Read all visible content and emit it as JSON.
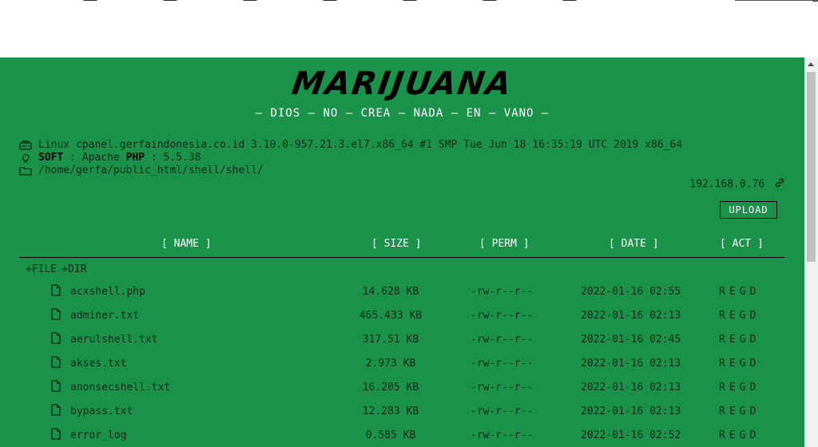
{
  "brand": {
    "logo": "MARIJUANA",
    "slogan": "— DIOS — NO — CREA — NADA — EN — VANO —"
  },
  "system_info": {
    "uname": "Linux cpanel.gerfaindonesia.co.id 3.10.0-957.21.3.el7.x86_64 #1 SMP Tue Jun 18 16:35:19 UTC 2019 x86_64",
    "soft_label": "SOFT",
    "soft_sep": " : Apache ",
    "php_label": "PHP",
    "php_value": " : 5.5.38",
    "path": "/home/gerfa/public_html/shell/shell/",
    "ip": "192.168.0.76"
  },
  "upload_label": "UPLOAD",
  "columns": {
    "name": "[ NAME ]",
    "size": "[ SIZE ]",
    "perm": "[ PERM ]",
    "date": "[ DATE ]",
    "act": "[ ACT ]"
  },
  "new_actions": {
    "file": "+FILE",
    "dir": "+DIR"
  },
  "action_letters": [
    "R",
    "E",
    "G",
    "D"
  ],
  "files": [
    {
      "name": "acxshell.php",
      "size": "14.628 KB",
      "perm": "-rw-r--r--",
      "date": "2022-01-16 02:55"
    },
    {
      "name": "adminer.txt",
      "size": "465.433 KB",
      "perm": "-rw-r--r--",
      "date": "2022-01-16 02:13"
    },
    {
      "name": "aerulshell.txt",
      "size": "317.51 KB",
      "perm": "-rw-r--r--",
      "date": "2022-01-16 02:45"
    },
    {
      "name": "akses.txt",
      "size": "2.973 KB",
      "perm": "-rw-r--r--",
      "date": "2022-01-16 02:13"
    },
    {
      "name": "anonsecshell.txt",
      "size": "16.205 KB",
      "perm": "-rw-r--r--",
      "date": "2022-01-16 02:13"
    },
    {
      "name": "bypass.txt",
      "size": "12.283 KB",
      "perm": "-rw-r--r--",
      "date": "2022-01-16 02:13"
    },
    {
      "name": "error_log",
      "size": "0.585 KB",
      "perm": "-rw-r--r--",
      "date": "2022-01-16 02:52"
    }
  ],
  "colors": {
    "background": "#1a924a",
    "text": "#0b2a16",
    "header": "#ffffff"
  }
}
